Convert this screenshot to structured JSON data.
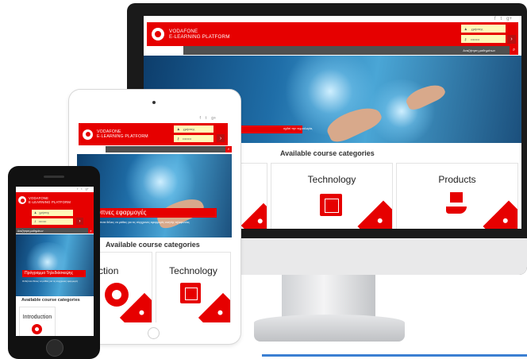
{
  "brand": {
    "line1": "VODAFONE",
    "line2": "E-LEARNING PLATFORM"
  },
  "colors": {
    "accent": "#e60000",
    "dark_bar": "#505050",
    "login_bg": "#fff9b8"
  },
  "social_icons": [
    "facebook-icon",
    "twitter-icon",
    "google-plus-icon"
  ],
  "social_glyphs": {
    "facebook": "f",
    "twitter": "t",
    "google": "g+"
  },
  "login": {
    "username_placeholder": "χρήστης",
    "password_placeholder": "••••••••",
    "submit_glyph": "›"
  },
  "search": {
    "label": "Αναζήτηση μαθημάτων",
    "button_glyph": "⌕"
  },
  "desktop": {
    "hero_sub": "οχθεί την τεχνολογία,",
    "section_title": "Available course categories",
    "categories": [
      "Technology",
      "Products"
    ]
  },
  "tablet": {
    "hero_caption": "ξυπνες εφαρμογές",
    "hero_sub": "Οτιδήποτε θέλεις να μάθεις για τις σύγχρονες εφαρμογές κινητής τηλεφωνίας",
    "section_title": "Available course categories",
    "categories": [
      "roduction",
      "Technology"
    ]
  },
  "phone": {
    "menu_label": "Αναζήτηση μαθημάτων",
    "hero_caption": "Πρόγραμμα Τηλεδιάσκεψης",
    "hero_sub": "Οτιδήποτε θέλεις να μάθεις για τις σύγχρονες εφαρμογές",
    "section_title": "Available course categories",
    "categories": [
      "Introduction"
    ]
  }
}
